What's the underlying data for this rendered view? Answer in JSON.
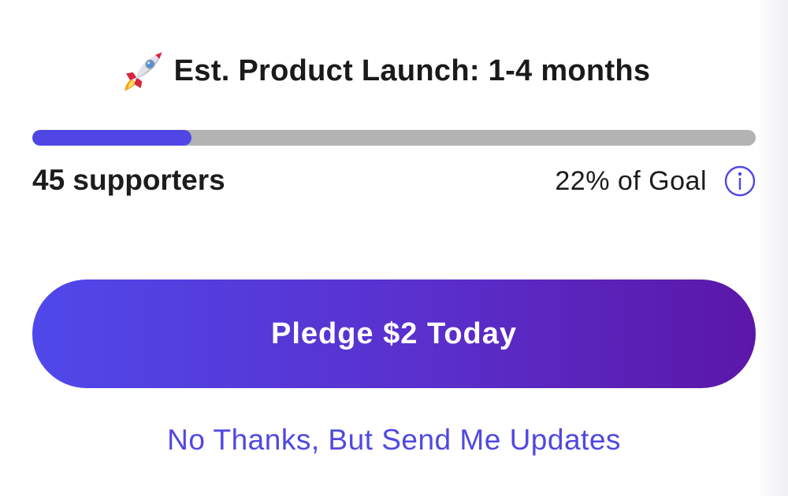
{
  "launch": {
    "icon": "rocket-icon",
    "text": "Est. Product Launch: 1-4 months"
  },
  "progress": {
    "percent": 22,
    "track_color": "#b3b3b3",
    "fill_color": "#4f46e5"
  },
  "stats": {
    "supporters": "45 supporters",
    "goal": "22% of Goal",
    "info_icon": "info-icon"
  },
  "actions": {
    "pledge_label": "Pledge $2 Today",
    "decline_label": "No Thanks, But Send Me Updates"
  },
  "colors": {
    "accent": "#4f46e5",
    "button_gradient_start": "#5048ea",
    "button_gradient_end": "#5b17a8",
    "link": "#5048e0"
  }
}
